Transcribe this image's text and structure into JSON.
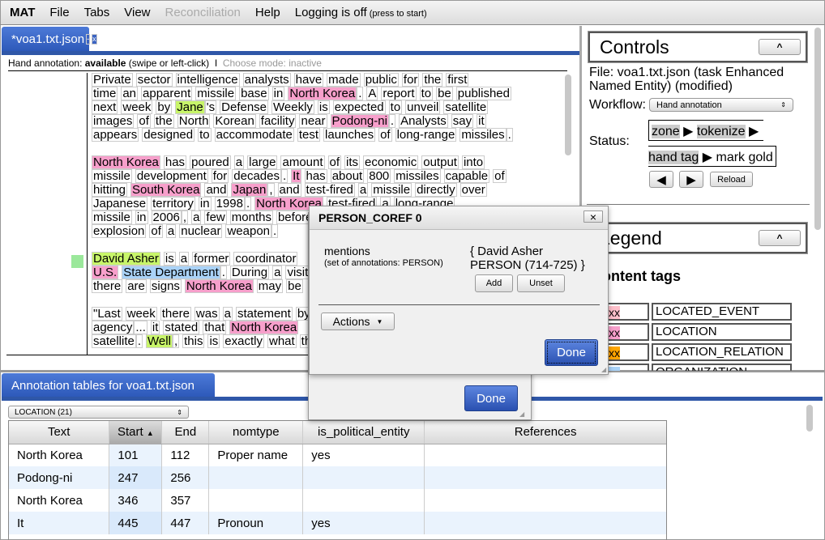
{
  "menubar": {
    "app": "MAT",
    "items": [
      "File",
      "Tabs",
      "View",
      "Reconciliation",
      "Help"
    ],
    "logging": "Logging is off",
    "logging_hint": "(press to start)"
  },
  "doc_tab": {
    "title": "*voa1.txt.json",
    "minimize": "-",
    "close": "x"
  },
  "info": {
    "label": "Hand annotation:",
    "state": "available",
    "hint": "(swipe or left-click)",
    "sep": "I",
    "mode": "Choose mode: inactive"
  },
  "tag_colors": {
    "LOCATION": "#f79fcb",
    "PERSON": "#c8f56a",
    "ORGANIZATION": "#a9d2f7",
    "LOCATED_EVENT": "#ffc0cb",
    "LOCATION_RELATION": "#ffa500"
  },
  "document": [
    [
      [
        "Private",
        "sector",
        "intelligence",
        "analysts",
        "have",
        "made",
        "public",
        "for",
        "the",
        "first"
      ],
      [
        "time",
        "an",
        "apparent",
        "missile",
        "base",
        "in",
        {
          "t": "North Korea",
          "tag": "LOCATION"
        },
        ".",
        "A",
        "report",
        "to",
        "be",
        "published"
      ],
      [
        "next",
        "week",
        "by",
        {
          "t": "Jane",
          "tag": "PERSON"
        },
        "'s",
        "Defense",
        "Weekly",
        "is",
        "expected",
        "to",
        "unveil",
        "satellite"
      ],
      [
        "images",
        "of",
        "the",
        "North",
        "Korean",
        "facility",
        "near",
        {
          "t": "Podong-ni",
          "tag": "LOCATION"
        },
        ".",
        "Analysts",
        "say",
        "it"
      ],
      [
        "appears",
        "designed",
        "to",
        "accommodate",
        "test",
        "launches",
        "of",
        "long-range",
        "missiles",
        "."
      ]
    ],
    [
      [
        {
          "t": "North Korea",
          "tag": "LOCATION"
        },
        "has",
        "poured",
        "a",
        "large",
        "amount",
        "of",
        "its",
        "economic",
        "output",
        "into"
      ],
      [
        "missile",
        "development",
        "for",
        "decades",
        ".",
        {
          "t": "It",
          "tag": "LOCATION"
        },
        "has",
        "about",
        "800",
        "missiles",
        "capable",
        "of"
      ],
      [
        "hitting",
        {
          "t": "South Korea",
          "tag": "LOCATION"
        },
        "and",
        {
          "t": "Japan",
          "tag": "LOCATION"
        },
        ",",
        "and",
        "test-fired",
        "a",
        "missile",
        "directly",
        "over"
      ],
      [
        "Japanese",
        "territory",
        "in",
        "1998",
        ".",
        {
          "t": "North Korea",
          "tag": "LOCATION"
        },
        "test-fired",
        "a",
        "long-range"
      ],
      [
        "missile",
        "in",
        "2006",
        ",",
        "a",
        "few",
        "months",
        "before"
      ],
      [
        "explosion",
        "of",
        "a",
        "nuclear",
        "weapon",
        "."
      ]
    ],
    [
      [
        {
          "t": "David Asher",
          "tag": "PERSON"
        },
        "is",
        "a",
        "former",
        "coordinator"
      ],
      [
        {
          "t": "U.S.",
          "tag": "LOCATION"
        },
        {
          "t": "State Department",
          "tag": "ORGANIZATION"
        },
        ".",
        "During",
        "a",
        "visit"
      ],
      [
        "there",
        "are",
        "signs",
        {
          "t": "North Korea",
          "tag": "LOCATION"
        },
        "may",
        "be"
      ]
    ],
    [
      [
        "\"Last",
        "week",
        "there",
        "was",
        "a",
        "statement",
        "by"
      ],
      [
        "agency",
        "...",
        "it",
        "stated",
        "that",
        {
          "t": "North Korea",
          "tag": "LOCATION"
        }
      ],
      [
        "satellite",
        ".",
        {
          "t": "Well",
          "tag": "PERSON"
        },
        ",",
        "this",
        "is",
        "exactly",
        "what",
        "they"
      ]
    ]
  ],
  "controls": {
    "title": "Controls",
    "collapse": "^",
    "file": "File: voa1.txt.json (task Enhanced Named Entity) (modified)",
    "workflow_label": "Workflow:",
    "workflow_value": "Hand annotation",
    "status_label": "Status:",
    "steps": [
      "zone",
      "tokenize",
      "hand tag",
      "mark gold"
    ],
    "reload": "Reload"
  },
  "legend": {
    "title": "Legend",
    "collapse": "^",
    "subtitle": "Content tags",
    "swatch_text": "xxxx",
    "tags": [
      {
        "name": "LOCATED_EVENT",
        "color": "#ffc0cb"
      },
      {
        "name": "LOCATION",
        "color": "#f79fcb"
      },
      {
        "name": "LOCATION_RELATION",
        "color": "#ffa500"
      },
      {
        "name": "ORGANIZATION",
        "color": "#a9d2f7"
      }
    ]
  },
  "tables": {
    "tab": "Annotation tables for voa1.txt.json",
    "select": "LOCATION (21)",
    "columns": [
      "Text",
      "Start",
      "End",
      "nomtype",
      "is_political_entity",
      "References"
    ],
    "sort_indicator": "▲",
    "rows": [
      [
        "North Korea",
        "101",
        "112",
        "Proper name",
        "yes",
        ""
      ],
      [
        "Podong-ni",
        "247",
        "256",
        "",
        "",
        ""
      ],
      [
        "North Korea",
        "346",
        "357",
        "",
        "",
        ""
      ],
      [
        "It",
        "445",
        "447",
        "Pronoun",
        "yes",
        ""
      ]
    ]
  },
  "back_dialog": {
    "done": "Done"
  },
  "dialog": {
    "title": "PERSON_COREF 0",
    "close": "×",
    "field": "mentions",
    "field_hint": "(set of annotations: PERSON)",
    "value_line1": "{ David Asher",
    "value_line2": "PERSON (714-725) }",
    "add": "Add",
    "unset": "Unset",
    "actions": "Actions",
    "done": "Done"
  }
}
